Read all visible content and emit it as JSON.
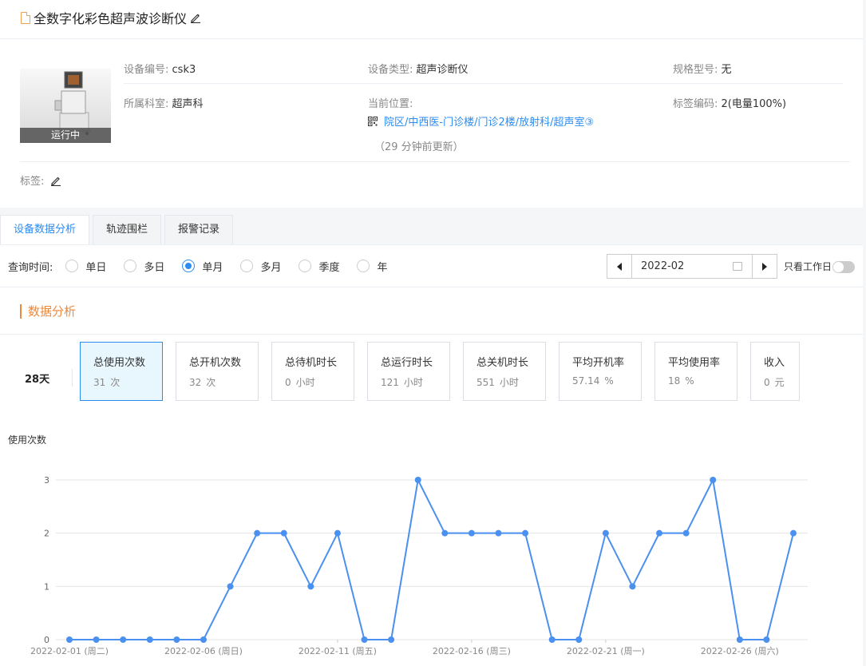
{
  "header": {
    "title": "全数字化彩色超声波诊断仪"
  },
  "device": {
    "status": "运行中",
    "fields": [
      {
        "label": "设备编号:",
        "value": "csk3"
      },
      {
        "label": "设备类型:",
        "value": "超声诊断仪"
      },
      {
        "label": "规格型号:",
        "value": "无"
      },
      {
        "label": "所属科室:",
        "value": "超声科"
      },
      {
        "label": "当前位置:",
        "value": ""
      },
      {
        "label": "标签编码:",
        "value": "2(电量100%)"
      }
    ],
    "location": "院区/中西医-门诊楼/门诊2楼/放射科/超声室③",
    "update_note": "（29 分钟前更新）",
    "tag_label": "标签:"
  },
  "tabs": [
    {
      "label": "设备数据分析",
      "active": true
    },
    {
      "label": "轨迹围栏",
      "active": false
    },
    {
      "label": "报警记录",
      "active": false
    }
  ],
  "query": {
    "label": "查询时间:",
    "options": [
      {
        "label": "单日",
        "checked": false
      },
      {
        "label": "多日",
        "checked": false
      },
      {
        "label": "单月",
        "checked": true
      },
      {
        "label": "多月",
        "checked": false
      },
      {
        "label": "季度",
        "checked": false
      },
      {
        "label": "年",
        "checked": false
      }
    ],
    "date": "2022-02",
    "work_days_label": "只看工作日"
  },
  "analysis": {
    "title": "数据分析",
    "days": "28天",
    "stats": [
      {
        "title": "总使用次数",
        "value": "31",
        "unit": "次",
        "active": true
      },
      {
        "title": "总开机次数",
        "value": "32",
        "unit": "次",
        "active": false
      },
      {
        "title": "总待机时长",
        "value": "0",
        "unit": "小时",
        "active": false
      },
      {
        "title": "总运行时长",
        "value": "121",
        "unit": "小时",
        "active": false
      },
      {
        "title": "总关机时长",
        "value": "551",
        "unit": "小时",
        "active": false
      },
      {
        "title": "平均开机率",
        "value": "57.14",
        "unit": "%",
        "active": false
      },
      {
        "title": "平均使用率",
        "value": "18",
        "unit": "%",
        "active": false
      },
      {
        "title": "收入",
        "value": "0",
        "unit": "元",
        "active": false
      }
    ]
  },
  "chart_data": {
    "type": "line",
    "ylabel": "使用次数",
    "ylim": [
      0,
      3
    ],
    "yticks": [
      0,
      1,
      2,
      3
    ],
    "x": [
      "2022-02-01",
      "2022-02-02",
      "2022-02-03",
      "2022-02-04",
      "2022-02-05",
      "2022-02-06",
      "2022-02-07",
      "2022-02-08",
      "2022-02-09",
      "2022-02-10",
      "2022-02-11",
      "2022-02-12",
      "2022-02-13",
      "2022-02-14",
      "2022-02-15",
      "2022-02-16",
      "2022-02-17",
      "2022-02-18",
      "2022-02-19",
      "2022-02-20",
      "2022-02-21",
      "2022-02-22",
      "2022-02-23",
      "2022-02-24",
      "2022-02-25",
      "2022-02-26",
      "2022-02-27",
      "2022-02-28"
    ],
    "xtick_labels": [
      {
        "date": "2022-02-01",
        "label": "2022-02-01 (周二)"
      },
      {
        "date": "2022-02-06",
        "label": "2022-02-06 (周日)"
      },
      {
        "date": "2022-02-11",
        "label": "2022-02-11 (周五)"
      },
      {
        "date": "2022-02-16",
        "label": "2022-02-16 (周三)"
      },
      {
        "date": "2022-02-21",
        "label": "2022-02-21 (周一)"
      },
      {
        "date": "2022-02-26",
        "label": "2022-02-26 (周六)"
      }
    ],
    "values": [
      0,
      0,
      0,
      0,
      0,
      0,
      1,
      2,
      2,
      1,
      2,
      0,
      0,
      3,
      2,
      2,
      2,
      2,
      0,
      0,
      2,
      1,
      2,
      2,
      3,
      0,
      0,
      2
    ],
    "line_color": "#4a90f0",
    "grid": true
  }
}
